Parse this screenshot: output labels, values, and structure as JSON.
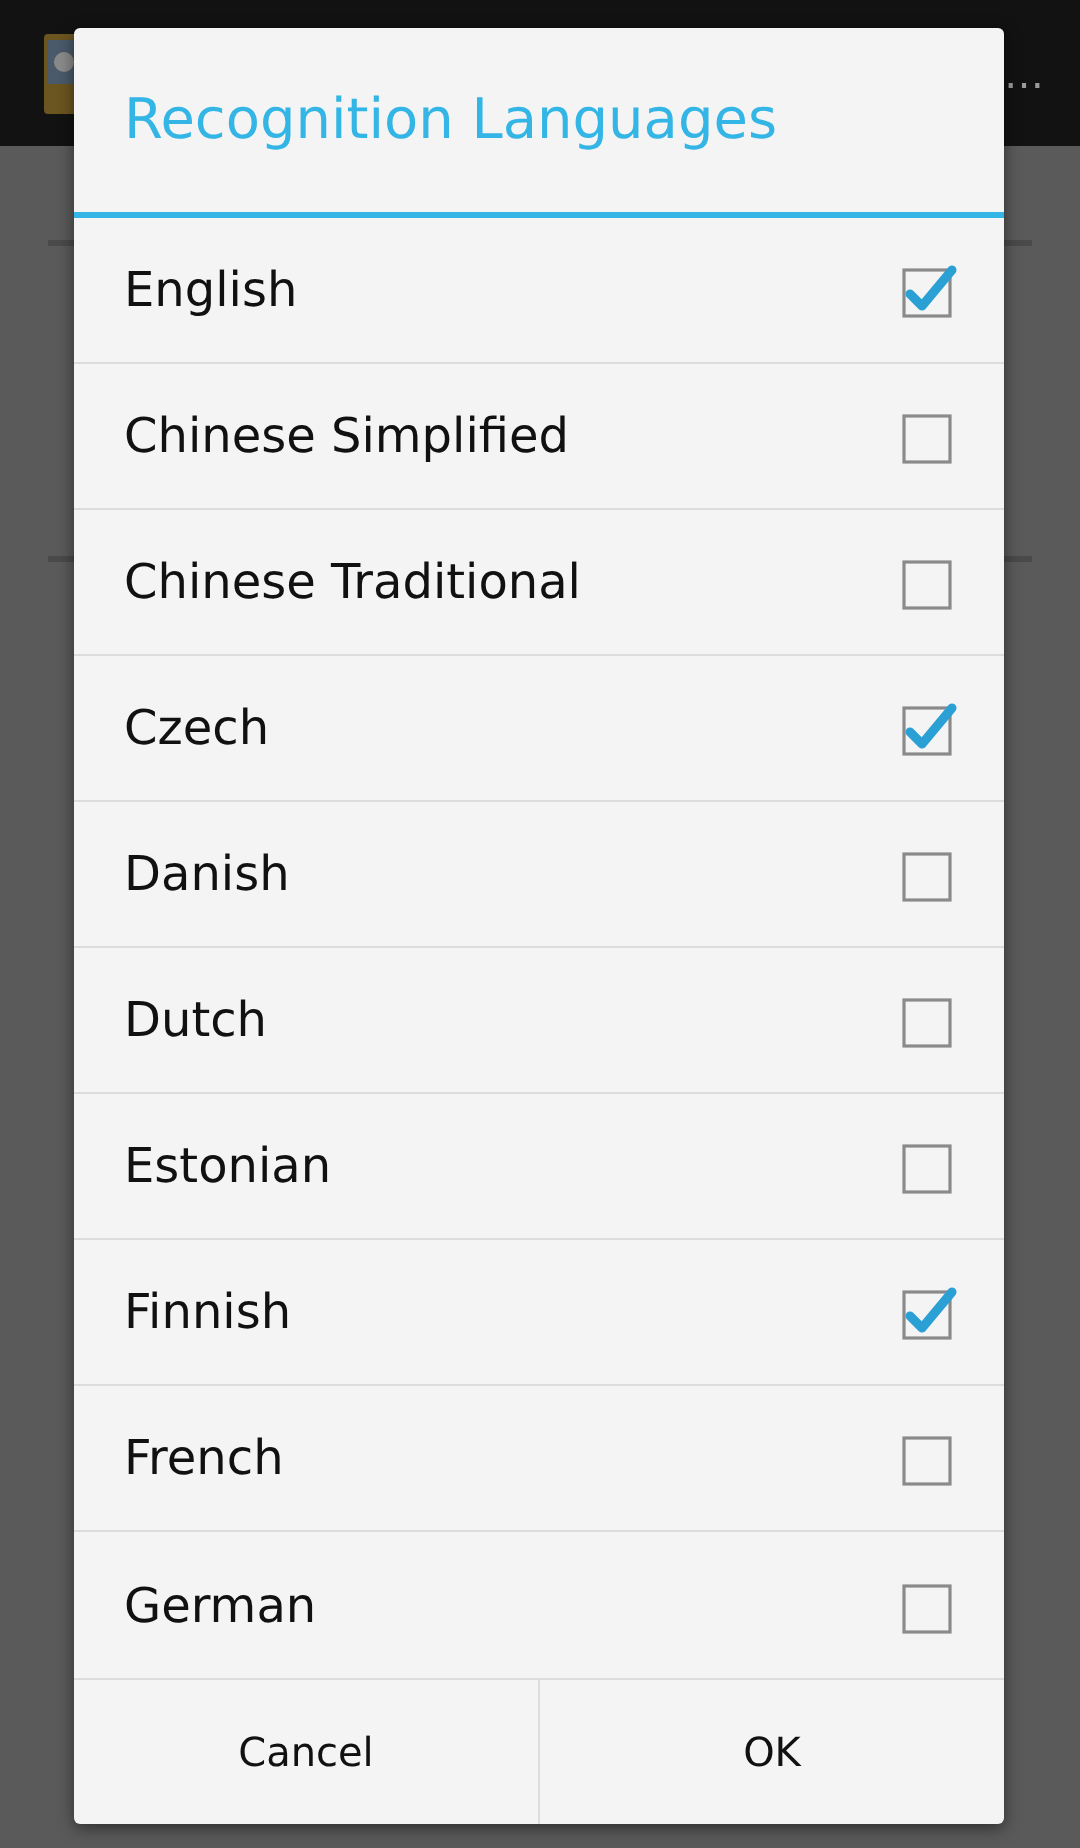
{
  "app_bar": {
    "title": "…"
  },
  "dialog": {
    "title": "Recognition Languages",
    "items": [
      {
        "label": "English",
        "checked": true
      },
      {
        "label": "Chinese Simplified",
        "checked": false
      },
      {
        "label": "Chinese Traditional",
        "checked": false
      },
      {
        "label": "Czech",
        "checked": true
      },
      {
        "label": "Danish",
        "checked": false
      },
      {
        "label": "Dutch",
        "checked": false
      },
      {
        "label": "Estonian",
        "checked": false
      },
      {
        "label": "Finnish",
        "checked": true
      },
      {
        "label": "French",
        "checked": false
      },
      {
        "label": "German",
        "checked": false
      }
    ],
    "buttons": [
      "Cancel",
      "OK"
    ]
  }
}
